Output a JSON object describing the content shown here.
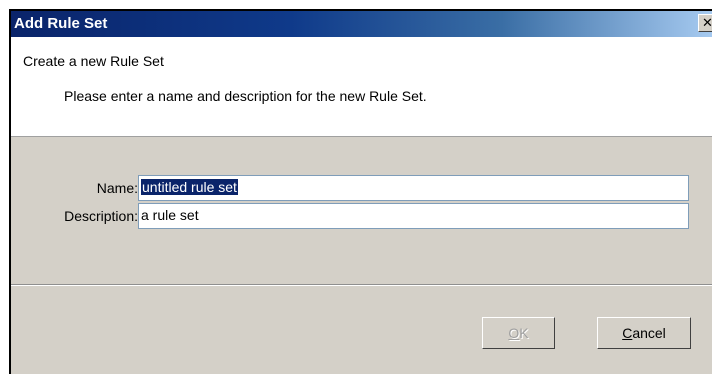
{
  "dialog": {
    "title": "Add Rule Set",
    "close_glyph": "✕"
  },
  "header": {
    "title": "Create a new Rule Set",
    "description": "Please enter a name and description for the new Rule Set."
  },
  "form": {
    "name_label": "Name:",
    "name_value": "untitled rule set",
    "description_label": "Description:",
    "description_value": "a rule set"
  },
  "buttons": {
    "ok_mnemonic": "O",
    "ok_rest": "K",
    "ok_enabled": false,
    "cancel_mnemonic": "C",
    "cancel_rest": "ancel"
  }
}
